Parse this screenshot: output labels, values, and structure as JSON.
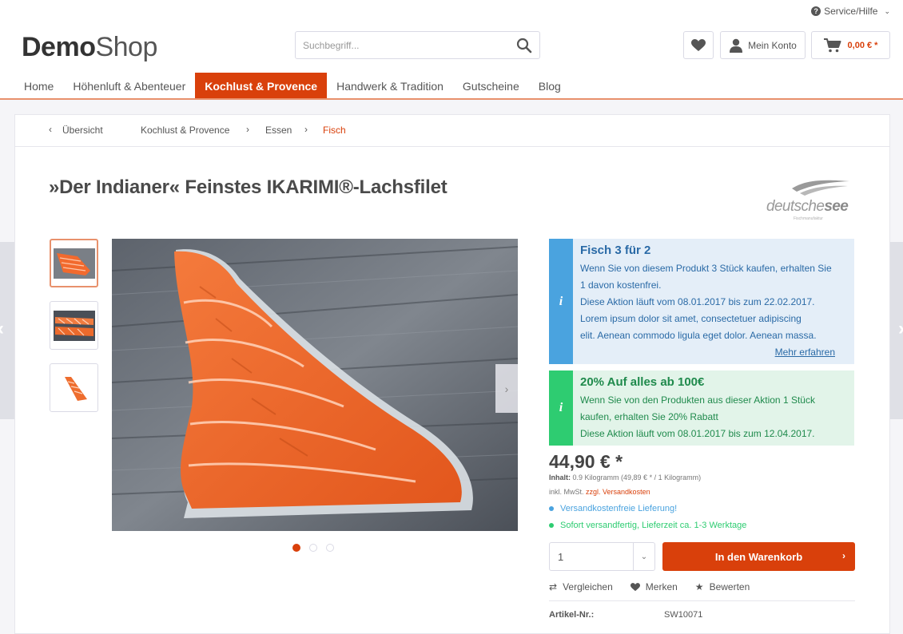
{
  "header": {
    "service_label": "Service/Hilfe",
    "logo_bold": "Demo",
    "logo_light": "Shop",
    "search_placeholder": "Suchbegriff...",
    "account_label": "Mein Konto",
    "cart_amount": "0,00 € *"
  },
  "nav": {
    "items": [
      "Home",
      "Höhenluft & Abenteuer",
      "Kochlust & Provence",
      "Handwerk & Tradition",
      "Gutscheine",
      "Blog"
    ],
    "active_index": 2
  },
  "breadcrumb": {
    "back": "Übersicht",
    "items": [
      "Kochlust & Provence",
      "Essen",
      "Fisch"
    ]
  },
  "product": {
    "title": "»Der Indianer« Feinstes IKARIMI®-Lachsfilet",
    "brand_name_light": "deutsche",
    "brand_name_bold": "see",
    "brand_sub": "Fischmanufaktur",
    "price": "44,90 € *",
    "content_label": "Inhalt:",
    "content_value": "0.9 Kilogramm (49,89 € * / 1 Kilogramm)",
    "tax_prefix": "inkl. MwSt.",
    "tax_link": "zzgl. Versandkosten",
    "delivery_1": "Versandkostenfreie Lieferung!",
    "delivery_2": "Sofort versandfertig, Lieferzeit ca. 1-3 Werktage",
    "quantity": "1",
    "buy_label": "In den Warenkorb",
    "actions": [
      "Vergleichen",
      "Merken",
      "Bewerten"
    ],
    "article_label": "Artikel-Nr.:",
    "article_value": "SW10071"
  },
  "promos": [
    {
      "title": "Fisch 3 für 2",
      "lines": [
        "Wenn Sie von diesem Produkt 3 Stück kaufen, erhalten Sie",
        "1 davon kostenfrei.",
        "Diese Aktion läuft vom 08.01.2017 bis zum 22.02.2017.",
        "Lorem ipsum dolor sit amet, consectetuer adipiscing",
        "elit. Aenean commodo ligula eget dolor. Aenean massa."
      ],
      "more": "Mehr erfahren"
    },
    {
      "title": "20% Auf alles ab 100€",
      "lines": [
        "Wenn Sie von den Produkten aus dieser Aktion 1 Stück",
        "kaufen, erhalten Sie 20% Rabatt",
        "Diese Aktion läuft vom 08.01.2017 bis zum 12.04.2017."
      ]
    }
  ],
  "gallery": {
    "active_index": 0,
    "count": 3
  },
  "colors": {
    "accent": "#d9400b",
    "info_blue": "#4aa3df",
    "success_green": "#2ecc71"
  },
  "icons": {
    "service": "question-circle-icon",
    "search": "search-icon",
    "wishlist": "heart-icon",
    "account": "user-icon",
    "cart": "cart-icon",
    "info": "info-icon"
  }
}
